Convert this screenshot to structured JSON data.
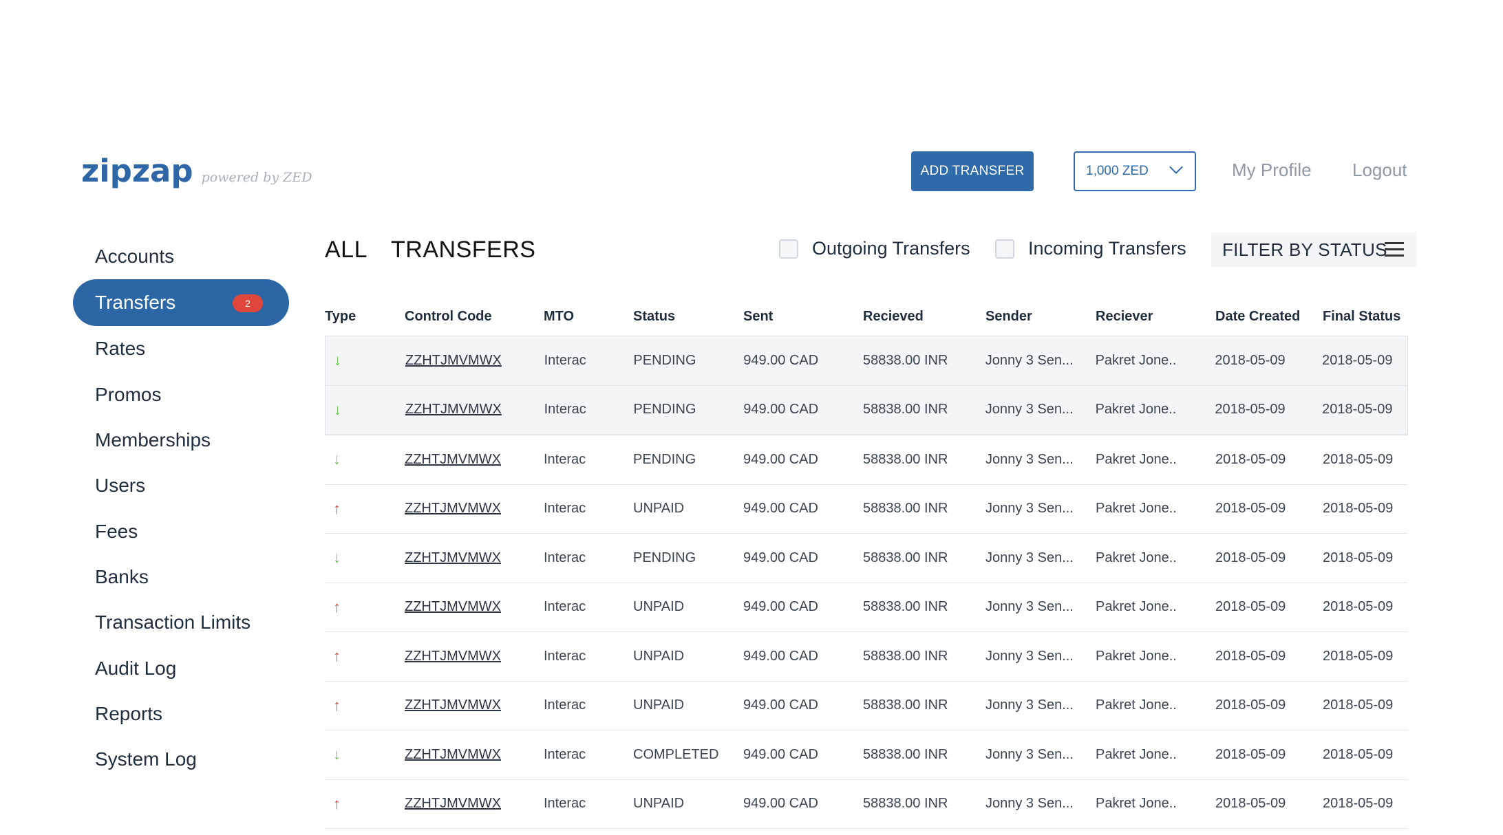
{
  "brand": {
    "name": "zipzap",
    "tagline": "powered by ZED"
  },
  "header": {
    "add_transfer": "ADD TRANSFER",
    "balance": "1,000 ZED",
    "profile": "My Profile",
    "logout": "Logout"
  },
  "sidebar": {
    "items": [
      {
        "label": "Accounts"
      },
      {
        "label": "Transfers",
        "badge": "2",
        "active": true
      },
      {
        "label": "Rates"
      },
      {
        "label": "Promos"
      },
      {
        "label": "Memberships"
      },
      {
        "label": "Users"
      },
      {
        "label": "Fees"
      },
      {
        "label": "Banks"
      },
      {
        "label": "Transaction Limits"
      },
      {
        "label": "Audit Log"
      },
      {
        "label": "Reports"
      },
      {
        "label": "System Log"
      }
    ]
  },
  "main": {
    "title": "ALL  TRANSFERS",
    "filters": {
      "outgoing": "Outgoing Transfers",
      "incoming": "Incoming Transfers",
      "by_status": "FILTER BY STATUS"
    },
    "columns": [
      "Type",
      "Control Code",
      "MTO",
      "Status",
      "Sent",
      "Recieved",
      "Sender",
      "Reciever",
      "Date Created",
      "Final Status"
    ],
    "rows": [
      {
        "type": "incoming",
        "code": "ZZHTJMVMWX",
        "mto": "Interac",
        "status": "PENDING",
        "sent": "949.00 CAD",
        "received": "58838.00 INR",
        "sender": "Jonny 3 Sen...",
        "receiver": "Pakret Jone..",
        "date_created": "2018-05-09",
        "final_status": "2018-05-09"
      },
      {
        "type": "incoming",
        "code": "ZZHTJMVMWX",
        "mto": "Interac",
        "status": "PENDING",
        "sent": "949.00 CAD",
        "received": "58838.00 INR",
        "sender": "Jonny 3 Sen...",
        "receiver": "Pakret Jone..",
        "date_created": "2018-05-09",
        "final_status": "2018-05-09"
      },
      {
        "type": "incoming",
        "code": "ZZHTJMVMWX",
        "mto": "Interac",
        "status": "PENDING",
        "sent": "949.00 CAD",
        "received": "58838.00 INR",
        "sender": "Jonny 3 Sen...",
        "receiver": "Pakret Jone..",
        "date_created": "2018-05-09",
        "final_status": "2018-05-09"
      },
      {
        "type": "outgoing",
        "code": "ZZHTJMVMWX",
        "mto": "Interac",
        "status": "UNPAID",
        "sent": "949.00 CAD",
        "received": "58838.00 INR",
        "sender": "Jonny 3 Sen...",
        "receiver": "Pakret Jone..",
        "date_created": "2018-05-09",
        "final_status": "2018-05-09"
      },
      {
        "type": "incoming",
        "code": "ZZHTJMVMWX",
        "mto": "Interac",
        "status": "PENDING",
        "sent": "949.00 CAD",
        "received": "58838.00 INR",
        "sender": "Jonny 3 Sen...",
        "receiver": "Pakret Jone..",
        "date_created": "2018-05-09",
        "final_status": "2018-05-09"
      },
      {
        "type": "outgoing",
        "code": "ZZHTJMVMWX",
        "mto": "Interac",
        "status": "UNPAID",
        "sent": "949.00 CAD",
        "received": "58838.00 INR",
        "sender": "Jonny 3 Sen...",
        "receiver": "Pakret Jone..",
        "date_created": "2018-05-09",
        "final_status": "2018-05-09"
      },
      {
        "type": "outgoing",
        "code": "ZZHTJMVMWX",
        "mto": "Interac",
        "status": "UNPAID",
        "sent": "949.00 CAD",
        "received": "58838.00 INR",
        "sender": "Jonny 3 Sen...",
        "receiver": "Pakret Jone..",
        "date_created": "2018-05-09",
        "final_status": "2018-05-09"
      },
      {
        "type": "outgoing",
        "code": "ZZHTJMVMWX",
        "mto": "Interac",
        "status": "UNPAID",
        "sent": "949.00 CAD",
        "received": "58838.00 INR",
        "sender": "Jonny 3 Sen...",
        "receiver": "Pakret Jone..",
        "date_created": "2018-05-09",
        "final_status": "2018-05-09"
      },
      {
        "type": "incoming",
        "code": "ZZHTJMVMWX",
        "mto": "Interac",
        "status": "COMPLETED",
        "sent": "949.00 CAD",
        "received": "58838.00 INR",
        "sender": "Jonny 3 Sen...",
        "receiver": "Pakret Jone..",
        "date_created": "2018-05-09",
        "final_status": "2018-05-09"
      },
      {
        "type": "outgoing",
        "code": "ZZHTJMVMWX",
        "mto": "Interac",
        "status": "UNPAID",
        "sent": "949.00 CAD",
        "received": "58838.00 INR",
        "sender": "Jonny 3 Sen...",
        "receiver": "Pakret Jone..",
        "date_created": "2018-05-09",
        "final_status": "2018-05-09"
      }
    ]
  },
  "icons": {
    "incoming": "arrow-down-icon",
    "outgoing": "arrow-up-icon",
    "incoming_color": "#6fbf4a",
    "outgoing_color": "#e0463c"
  },
  "colors": {
    "brand": "#2f66a7",
    "badge": "#e0463c"
  }
}
